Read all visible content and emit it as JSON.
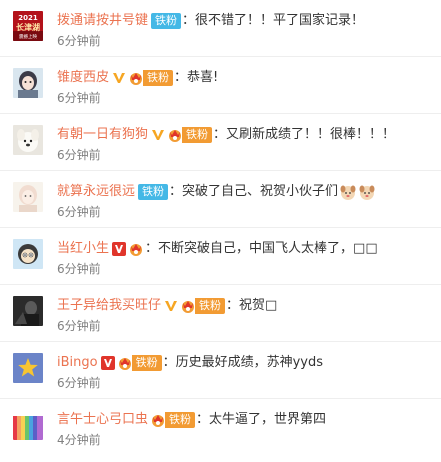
{
  "colors": {
    "username": "#eb7350",
    "text": "#333333",
    "time": "#808080",
    "fan_blue": "#44b8e6",
    "fan_orange": "#f29b33",
    "vip_orange": "#f6a623",
    "vip_red": "#e0352b"
  },
  "comments": [
    {
      "username": "拨通请按井号键",
      "avatar_icon": "changjinhu-2021-poster",
      "avatar_text_year": "2021",
      "avatar_text_title": "长津湖",
      "avatar_text_sub": "震撼上映",
      "vip_icon": "none",
      "fan_badge": "铁粉",
      "fan_badge_style": "blue",
      "text": "很不错了！！平了国家记录！",
      "time": "6分钟前"
    },
    {
      "username": "锥度西皮",
      "avatar_icon": "anime-girl-avatar",
      "vip_icon": "orange-v-icon",
      "fan_badge": "铁粉",
      "fan_badge_style": "orange",
      "text": "恭喜!",
      "time": "6分钟前"
    },
    {
      "username": "有朝一日有狗狗",
      "avatar_icon": "white-dog-avatar",
      "vip_icon": "orange-v-icon",
      "fan_badge": "铁粉",
      "fan_badge_style": "orange",
      "text": "又刷新成绩了！！很棒！！！",
      "time": "6分钟前"
    },
    {
      "username": "就算永远很远",
      "avatar_icon": "sketch-girl-avatar",
      "vip_icon": "none",
      "fan_badge": "铁粉",
      "fan_badge_style": "blue",
      "text": "突破了自己、祝贺小伙子们",
      "emoji": "two-cheering-dog-emoji",
      "time": "6分钟前"
    },
    {
      "username": "当红小生",
      "avatar_icon": "cartoon-character-avatar",
      "vip_icon": "red-v-icon",
      "fan_badge": "",
      "fan_badge_style": "none",
      "text": "不断突破自己，中国飞人太棒了，□□",
      "time": "6分钟前"
    },
    {
      "username": "王子异给我买旺仔",
      "avatar_icon": "dark-photo-avatar",
      "vip_icon": "orange-v-icon",
      "fan_badge": "铁粉",
      "fan_badge_style": "orange",
      "text": "祝贺□",
      "time": "6分钟前"
    },
    {
      "username": "iBingo",
      "avatar_icon": "yellow-star-avatar",
      "vip_icon": "red-v-icon",
      "fan_badge": "铁粉",
      "fan_badge_style": "orange",
      "text": "历史最好成绩，苏神yyds",
      "time": "6分钟前"
    },
    {
      "username": "言午士心弓口虫",
      "avatar_icon": "rainbow-stripes-avatar",
      "vip_icon": "none",
      "fan_badge": "铁粉",
      "fan_badge_style": "orange",
      "text": "太牛逼了，世界第四",
      "time": "4分钟前"
    }
  ]
}
